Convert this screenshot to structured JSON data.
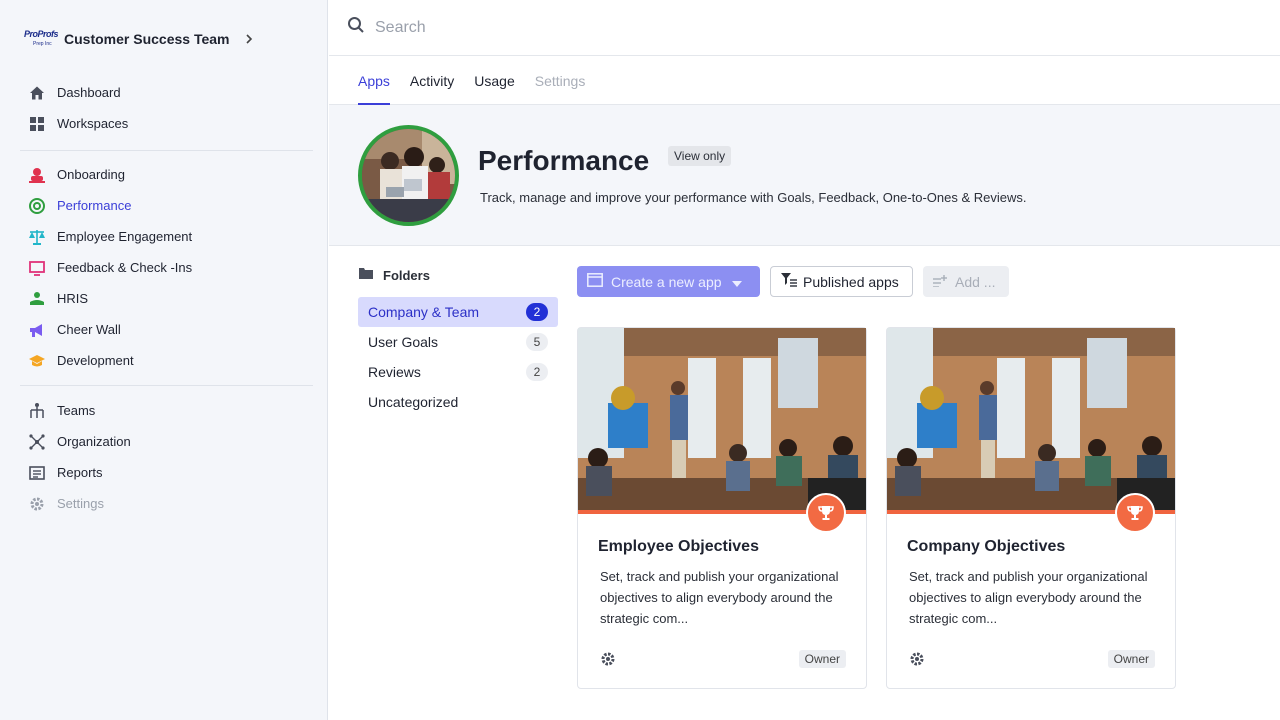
{
  "sidebar": {
    "team_name": "Customer Success Team",
    "logo_text": "ProProfs",
    "logo_sub": "Prep Inc",
    "primary": [
      {
        "label": "Dashboard",
        "icon": "home-icon"
      },
      {
        "label": "Workspaces",
        "icon": "grid-icon"
      }
    ],
    "apps": [
      {
        "label": "Onboarding",
        "icon": "onboarding-icon",
        "color": "#e0334f"
      },
      {
        "label": "Performance",
        "icon": "target-icon",
        "color": "#2f9e3f"
      },
      {
        "label": "Employee Engagement",
        "icon": "scale-icon",
        "color": "#21b6c9"
      },
      {
        "label": "Feedback & Check -Ins",
        "icon": "monitor-icon",
        "color": "#e0337a"
      },
      {
        "label": "HRIS",
        "icon": "hand-person-icon",
        "color": "#2f9e3f"
      },
      {
        "label": "Cheer Wall",
        "icon": "megaphone-icon",
        "color": "#7a5cf0"
      },
      {
        "label": "Development",
        "icon": "graduation-cap-icon",
        "color": "#f5a623"
      }
    ],
    "admin": [
      {
        "label": "Teams",
        "icon": "hierarchy-icon"
      },
      {
        "label": "Organization",
        "icon": "network-icon"
      },
      {
        "label": "Reports",
        "icon": "report-icon"
      },
      {
        "label": "Settings",
        "icon": "gear-icon"
      }
    ],
    "active_item": "Performance"
  },
  "search": {
    "placeholder": "Search"
  },
  "tabs": [
    {
      "label": "Apps",
      "state": "active"
    },
    {
      "label": "Activity",
      "state": "normal"
    },
    {
      "label": "Usage",
      "state": "normal"
    },
    {
      "label": "Settings",
      "state": "disabled"
    }
  ],
  "hero": {
    "title": "Performance",
    "badge": "View only",
    "description": "Track, manage and improve your performance with Goals, Feedback, One-to-Ones & Reviews."
  },
  "folders": {
    "heading": "Folders",
    "items": [
      {
        "label": "Company & Team",
        "count": "2",
        "active": true
      },
      {
        "label": "User Goals",
        "count": "5"
      },
      {
        "label": "Reviews",
        "count": "2"
      },
      {
        "label": "Uncategorized",
        "count": ""
      }
    ]
  },
  "toolbar": {
    "create_label": "Create a new app",
    "published_label": "Published apps",
    "add_label": "Add ..."
  },
  "cards": [
    {
      "title": "Employee Objectives",
      "description": "Set, track and publish your organizational objectives to align everybody around the strategic com...",
      "role": "Owner"
    },
    {
      "title": "Company Objectives",
      "description": "Set, track and publish your organizational objectives to align everybody around the strategic com...",
      "role": "Owner"
    }
  ],
  "colors": {
    "accent": "#3b3fd8",
    "trophy": "#f26a43",
    "create_button": "#8c8ff2"
  }
}
